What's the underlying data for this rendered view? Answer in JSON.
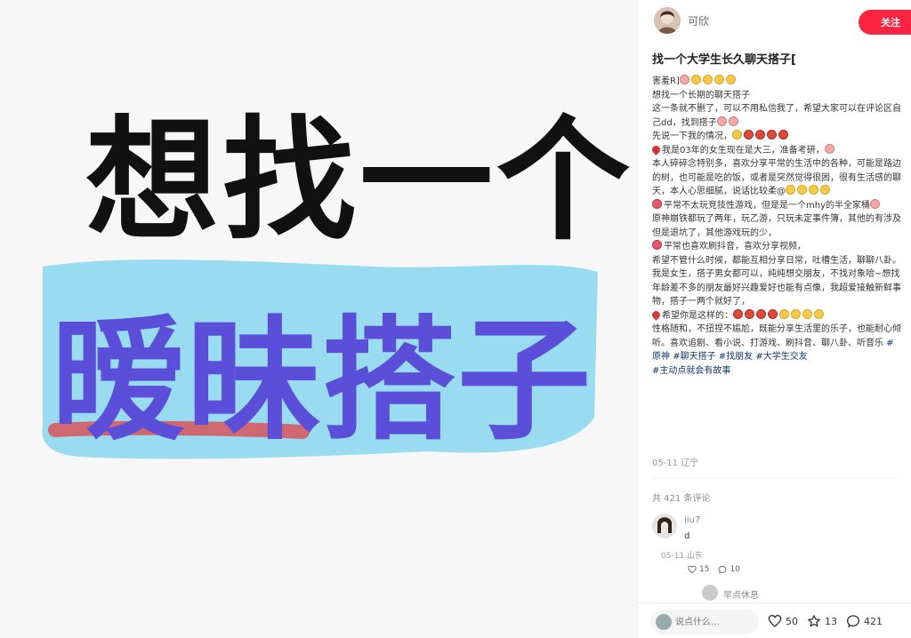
{
  "media": {
    "line1": "想找一个",
    "line2": "暧昧搭子"
  },
  "author": {
    "name": "可欣",
    "follow_label": "关注"
  },
  "note": {
    "title": "找一个大学生长久聊天搭子[",
    "lines": [
      "害羞R]",
      "想找一个长期的聊天搭子",
      "这一条就不删了，可以不用私信我了，希望大家可以在评论区自己dd，找到搭子",
      "先说一下我的情况，",
      "我是03年的女生现在是大三，准备考研，",
      "本人碎碎念特别多，喜欢分享平常的生活中的各种，可能是路边的树，也可能是吃的饭，或者是突然觉得很困，很有生活感的聊天，本人心思细腻，说话比较柔@",
      "平常不太玩竞技性游戏，但是是一个mhy的半全家桶",
      "原神崩铁都玩了两年，玩乙游，只玩未定事件簿，其他的有涉及但是退坑了，其他游戏玩的少，",
      "平常也喜欢刷抖音，喜欢分享视频，",
      "希望不管什么时候，都能互相分享日常，吐槽生活，聊聊八卦。我是女生，搭子男女都可以，纯纯想交朋友，不找对象哈~想找年龄差不多的朋友最好兴趣爱好也能有点像，我超爱接触新鲜事物，搭子一两个就好了，",
      "希望你是这样的：",
      "性格随和，不扭捏不尴尬，既能分享生活里的乐子，也能耐心倾听。喜欢追剧、看小说、打游戏、刷抖音、聊八卦、听音乐",
      "#主动点就会有故事"
    ],
    "tags_inline": [
      "#原神",
      "#聊天搭子",
      "#找朋友",
      "#大学生交友"
    ],
    "date_location": "05-11 辽宁"
  },
  "comments": {
    "count_label": "共 421 条评论",
    "items": [
      {
        "user": "iiu7",
        "text": "d",
        "meta": "05-11 山东",
        "likes": "15",
        "replies": "10"
      }
    ],
    "reply_preview_user": "早点休息"
  },
  "bottom_bar": {
    "input_placeholder": "说点什么...",
    "likes": "50",
    "collects": "13",
    "comments": "421"
  },
  "colors": {
    "accent": "#ff2442",
    "highlight_blue": "#8ed8f0",
    "purple_text": "#5b4fd9",
    "underline_red": "#d9545c"
  }
}
